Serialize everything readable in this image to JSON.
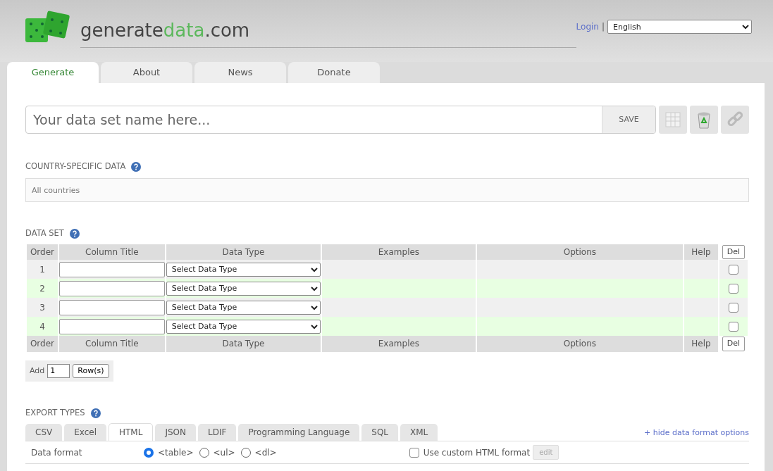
{
  "logo": {
    "prefix": "generate",
    "highlight": "data",
    "suffix": ".com"
  },
  "header": {
    "login": "Login",
    "separator": "|",
    "language": "English"
  },
  "tabs": [
    {
      "label": "Generate",
      "selected": true
    },
    {
      "label": "About",
      "selected": false
    },
    {
      "label": "News",
      "selected": false
    },
    {
      "label": "Donate",
      "selected": false
    }
  ],
  "dataset_name": {
    "placeholder": "Your data set name here...",
    "save_label": "SAVE"
  },
  "country_section": {
    "title": "COUNTRY-SPECIFIC DATA",
    "placeholder": "All countries"
  },
  "data_set": {
    "title": "DATA SET",
    "columns": [
      "Order",
      "Column Title",
      "Data Type",
      "Examples",
      "Options",
      "Help",
      "Del"
    ],
    "rows": [
      {
        "order": "1",
        "data_type": "Select Data Type",
        "delete_checked": false
      },
      {
        "order": "2",
        "data_type": "Select Data Type",
        "delete_checked": false
      },
      {
        "order": "3",
        "data_type": "Select Data Type",
        "delete_checked": false
      },
      {
        "order": "4",
        "data_type": "Select Data Type",
        "delete_checked": false
      }
    ],
    "footer_columns": [
      "Order",
      "Column Title",
      "Data Type",
      "Examples",
      "Options",
      "Help",
      "Del"
    ],
    "add": {
      "label": "Add",
      "value": "1",
      "button": "Row(s)"
    }
  },
  "export_types": {
    "title": "EXPORT TYPES",
    "tabs": [
      {
        "label": "CSV",
        "selected": false
      },
      {
        "label": "Excel",
        "selected": false
      },
      {
        "label": "HTML",
        "selected": true
      },
      {
        "label": "JSON",
        "selected": false
      },
      {
        "label": "LDIF",
        "selected": false
      },
      {
        "label": "Programming Language",
        "selected": false
      },
      {
        "label": "SQL",
        "selected": false
      },
      {
        "label": "XML",
        "selected": false
      }
    ],
    "toggle_link": "+ hide data format options",
    "data_format": {
      "label": "Data format",
      "options": [
        {
          "label": "<table>",
          "selected": true
        },
        {
          "label": "<ul>",
          "selected": false
        },
        {
          "label": "<dl>",
          "selected": false
        }
      ]
    },
    "custom_format": {
      "label": "Use custom HTML format",
      "checked": false,
      "edit_label": "edit",
      "edit_disabled": true
    }
  }
}
